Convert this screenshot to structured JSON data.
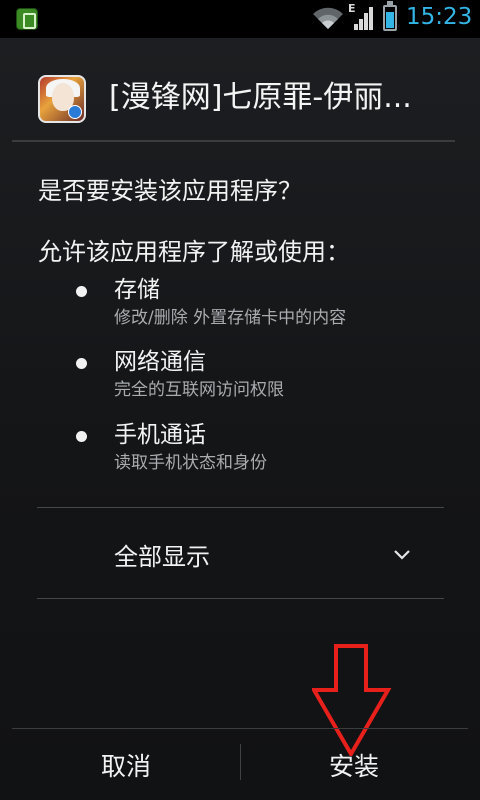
{
  "status_bar": {
    "time": "15:23",
    "network_type": "E",
    "notification_icon": "phone-notification-icon",
    "wifi_icon": "wifi-icon",
    "signal_icon": "cell-signal-icon",
    "battery_icon": "battery-icon",
    "battery_level": 0.75,
    "accent_color": "#33b5e5"
  },
  "header": {
    "app_icon": "app-icon",
    "app_title": "[漫锋网]七原罪-伊丽..."
  },
  "dialog": {
    "question": "是否要安装该应用程序？",
    "permissions_header": "允许该应用程序了解或使用：",
    "permissions": [
      {
        "title": "存储",
        "description": "修改/删除 外置存储卡中的内容"
      },
      {
        "title": "网络通信",
        "description": "完全的互联网访问权限"
      },
      {
        "title": "手机通话",
        "description": "读取手机状态和身份"
      }
    ],
    "show_all_label": "全部显示",
    "show_all_icon": "chevron-down-icon"
  },
  "buttons": {
    "cancel_label": "取消",
    "install_label": "安装"
  },
  "annotation": {
    "arrow_icon": "arrow-down-icon",
    "arrow_color": "#e8201c"
  }
}
